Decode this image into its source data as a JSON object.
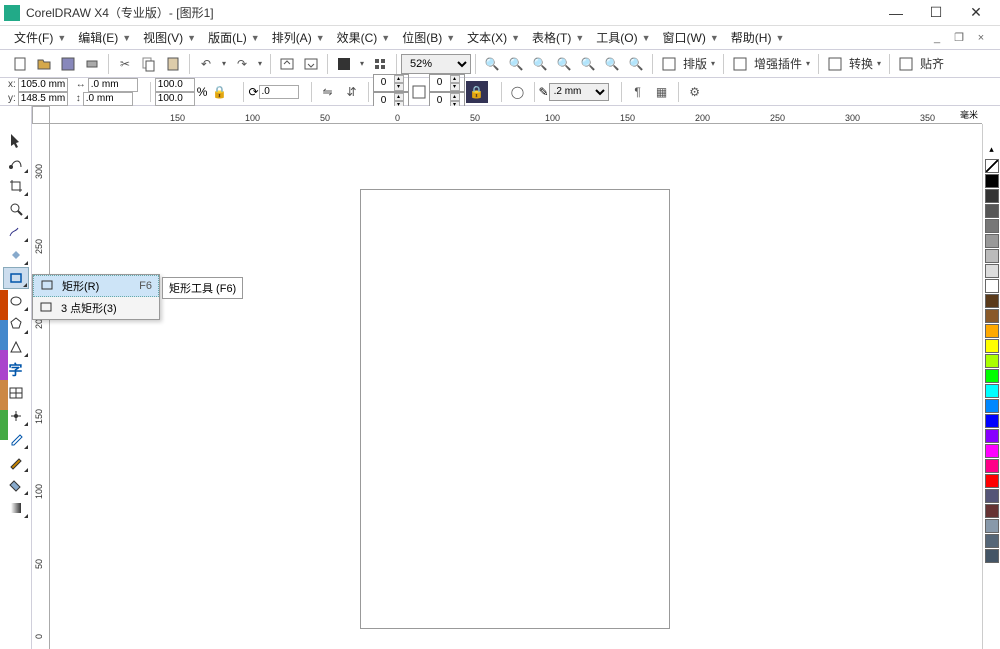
{
  "app": {
    "title": "CorelDRAW X4（专业版）- [图形1]"
  },
  "menus": [
    {
      "label": "文件(F)",
      "arrow": true
    },
    {
      "label": "编辑(E)",
      "arrow": true
    },
    {
      "label": "视图(V)",
      "arrow": true
    },
    {
      "label": "版面(L)",
      "arrow": true
    },
    {
      "label": "排列(A)",
      "arrow": true
    },
    {
      "label": "效果(C)",
      "arrow": true
    },
    {
      "label": "位图(B)",
      "arrow": true
    },
    {
      "label": "文本(X)",
      "arrow": true
    },
    {
      "label": "表格(T)",
      "arrow": true
    },
    {
      "label": "工具(O)",
      "arrow": true
    },
    {
      "label": "窗口(W)",
      "arrow": true
    },
    {
      "label": "帮助(H)",
      "arrow": true
    }
  ],
  "toolbar": {
    "zoom": "52%",
    "btns_right": [
      {
        "label": "排版"
      },
      {
        "label": "增强插件"
      },
      {
        "label": "转换"
      },
      {
        "label": "贴齐"
      }
    ]
  },
  "properties": {
    "x_label": "x:",
    "y_label": "y:",
    "x_val": "105.0 mm",
    "y_val": "148.5 mm",
    "w_val": ".0 mm",
    "h_val": ".0 mm",
    "scale_x": "100.0",
    "scale_y": "100.0",
    "rotation": ".0",
    "corner1": "0",
    "corner2": "0",
    "corner3": "0",
    "corner4": "0",
    "outline": ".2 mm"
  },
  "ruler_h": [
    {
      "pos": 120,
      "label": "150"
    },
    {
      "pos": 195,
      "label": "100"
    },
    {
      "pos": 270,
      "label": "50"
    },
    {
      "pos": 345,
      "label": "0"
    },
    {
      "pos": 420,
      "label": "50"
    },
    {
      "pos": 495,
      "label": "100"
    },
    {
      "pos": 570,
      "label": "150"
    },
    {
      "pos": 645,
      "label": "200"
    },
    {
      "pos": 720,
      "label": "250"
    },
    {
      "pos": 795,
      "label": "300"
    },
    {
      "pos": 870,
      "label": "350"
    }
  ],
  "ruler_h_unit": "毫米",
  "ruler_v": [
    {
      "pos": 40,
      "label": "300"
    },
    {
      "pos": 115,
      "label": "250"
    },
    {
      "pos": 190,
      "label": "200"
    },
    {
      "pos": 285,
      "label": "150"
    },
    {
      "pos": 360,
      "label": "100"
    },
    {
      "pos": 435,
      "label": "50"
    },
    {
      "pos": 510,
      "label": "0"
    }
  ],
  "flyout": {
    "items": [
      {
        "label": "矩形(R)",
        "shortcut": "F6",
        "active": true
      },
      {
        "label": "3 点矩形(3)",
        "shortcut": "",
        "active": false
      }
    ]
  },
  "tooltip": "矩形工具 (F6)",
  "palette": [
    "nocolor",
    "#000000",
    "#333333",
    "#555555",
    "#777777",
    "#999999",
    "#bbbbbb",
    "#dddddd",
    "#ffffff",
    "#5a3a1a",
    "#8a5a2a",
    "#ffaa00",
    "#ffff00",
    "#aaff00",
    "#00ff00",
    "#00ffff",
    "#0088ff",
    "#0000ff",
    "#8800ff",
    "#ff00ff",
    "#ff0088",
    "#ff0000",
    "#555577",
    "#663333",
    "#8899aa",
    "#556677",
    "#445566"
  ]
}
